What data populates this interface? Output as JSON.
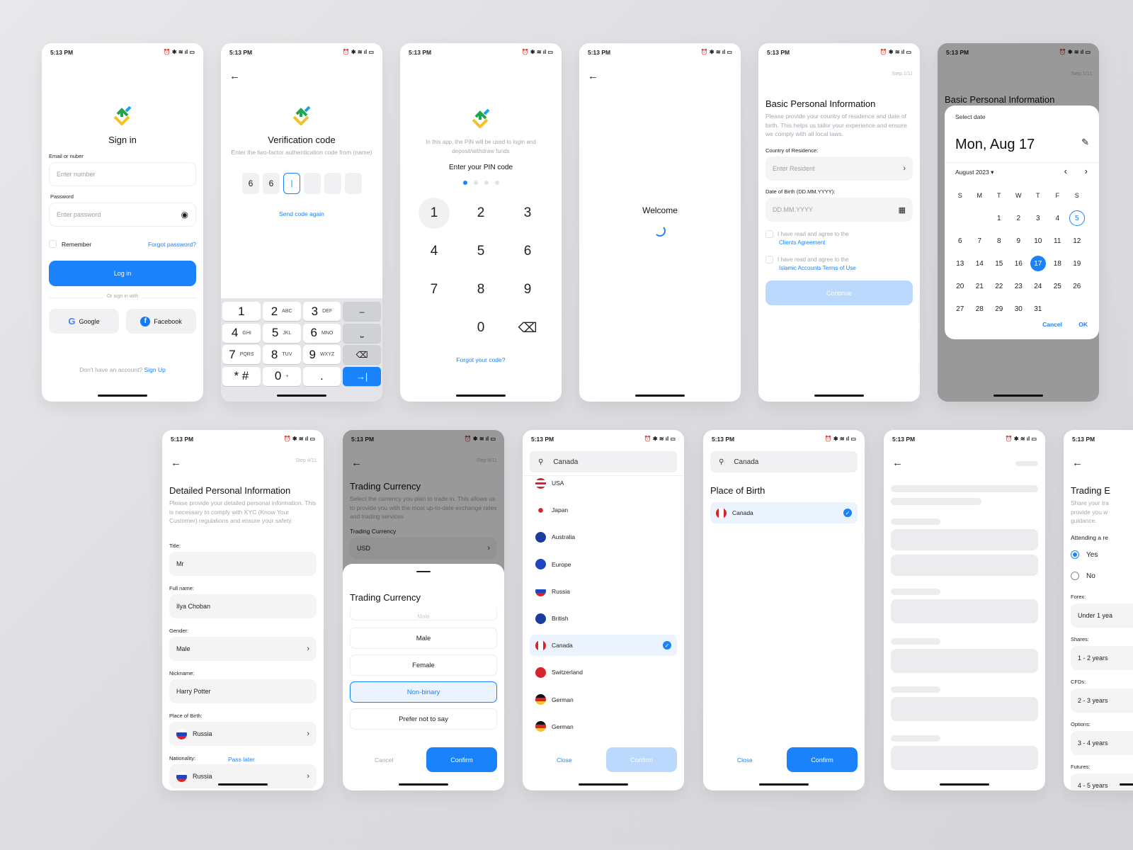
{
  "status": {
    "time": "5:13 PM",
    "icons": [
      "alarm-icon",
      "bluetooth-icon",
      "wifi-icon",
      "signal-icon",
      "battery-icon"
    ]
  },
  "brand": {
    "accent": "#1a82fb",
    "logo_colors": [
      "#1fa64a",
      "#1aa3e8",
      "#f5c02b"
    ]
  },
  "signin": {
    "title": "Sign in",
    "email_label": "Email or nuber",
    "email_placeholder": "Enter number",
    "password_label": "Password",
    "password_placeholder": "Enter password",
    "remember": "Remember",
    "forgot": "Forgot password?",
    "login": "Log in",
    "or": "Or sign in with",
    "google": "Google",
    "facebook": "Facebook",
    "no_account": "Don't have an account?",
    "signup": "Sign Up"
  },
  "verify": {
    "title": "Verification code",
    "subtitle": "Enter the two-factor authentication code from (name)",
    "digits": [
      "6",
      "6",
      "|",
      "",
      "",
      ""
    ],
    "resend": "Send code again",
    "keys": [
      [
        "1",
        ""
      ],
      [
        "2",
        "ABC"
      ],
      [
        "3",
        "DEF"
      ],
      [
        "–",
        ""
      ],
      [
        "4",
        "GHI"
      ],
      [
        "5",
        "JKL"
      ],
      [
        "6",
        "MNO"
      ],
      [
        "⎵",
        ""
      ],
      [
        "7",
        "PQRS"
      ],
      [
        "8",
        "TUV"
      ],
      [
        "9",
        "WXYZ"
      ],
      [
        "⌫",
        ""
      ],
      [
        "* #",
        ""
      ],
      [
        "0",
        "+"
      ],
      [
        ".",
        ""
      ],
      [
        "→|",
        ""
      ]
    ]
  },
  "pin": {
    "info": "In this app, the PIN will be used to login and deposit/withdraw funds",
    "title": "Enter your PIN code",
    "filled": 1,
    "total": 4,
    "keys": [
      "1",
      "2",
      "3",
      "4",
      "5",
      "6",
      "7",
      "8",
      "9",
      "",
      "0",
      "⌫"
    ],
    "forgot": "Forgot your code?"
  },
  "welcome": {
    "title": "Welcome"
  },
  "basic": {
    "step": "Step 1/11",
    "title": "Basic Personal Information",
    "subtitle": "Please provide your country of residence and date of birth. This helps us tailor your experience and ensure we comply with all local laws.",
    "country_label": "Country of Residence:",
    "country_placeholder": "Enter Resident",
    "dob_label": "Date of Birth (DD.MM.YYYY):",
    "dob_placeholder": "DD.MM.YYYY",
    "agree_text": "I have read and agree to the",
    "agree1_link": "Clients Agreement",
    "agree2_link": "Islamic Accounts Terms of Use",
    "continue": "Continue"
  },
  "datepicker": {
    "step": "Step 1/11",
    "bg_title": "Basic Personal Information",
    "header": "Select date",
    "selected": "Mon, Aug 17",
    "month": "August 2023",
    "weekdays": [
      "S",
      "M",
      "T",
      "W",
      "T",
      "F",
      "S"
    ],
    "days": [
      "",
      "",
      "1",
      "2",
      "3",
      "4",
      "5",
      "6",
      "7",
      "8",
      "9",
      "10",
      "11",
      "12",
      "13",
      "14",
      "15",
      "16",
      "17",
      "18",
      "19",
      "20",
      "21",
      "22",
      "23",
      "24",
      "25",
      "26",
      "27",
      "28",
      "29",
      "30",
      "31"
    ],
    "selected_day": "17",
    "today": "5",
    "cancel": "Cancel",
    "ok": "OK"
  },
  "detailed": {
    "step": "Step 4/11",
    "title": "Detailed Personal Information",
    "subtitle": "Please provide your detailed personal information. This is necessary to comply with KYC (Know Your Customer) regulations and ensure your safety.",
    "fields": [
      {
        "label": "Title:",
        "value": "Mr"
      },
      {
        "label": "Full name:",
        "value": "Ilya Choban"
      },
      {
        "label": "Gender:",
        "value": "Male"
      },
      {
        "label": "Nickname:",
        "value": "Harry Potter"
      },
      {
        "label": "Place of Birth:",
        "value": "Russia"
      },
      {
        "label": "Nationality:",
        "value": "Russia"
      }
    ],
    "pass_later": "Pass later"
  },
  "trading": {
    "step": "Step 8/11",
    "title": "Trading Currency",
    "subtitle": "Select the currency you plan to trade in. This allows us to provide you with the most up-to-date exchange rates and trading services",
    "label": "Trading Currency",
    "value": "USD",
    "sheet_title": "Trading Currency",
    "options": [
      "Male",
      "Male",
      "Female",
      "Non-binary",
      "Prefer not to say"
    ],
    "selected": "Non-binary",
    "cancel": "Cancel",
    "confirm": "Confirm"
  },
  "countries": {
    "search": "Canada",
    "items": [
      "USA",
      "Japan",
      "Australia",
      "Europe",
      "Russia",
      "British",
      "Canada",
      "Switzerland",
      "German",
      "German"
    ],
    "selected": "Canada",
    "close": "Close",
    "confirm": "Confirm"
  },
  "birthplace": {
    "search": "Canada",
    "title": "Place of Birth",
    "item": "Canada",
    "close": "Close",
    "confirm": "Confirm"
  },
  "experience": {
    "title": "Trading E",
    "subtitle": "Share your tra provide you w guidance.",
    "question": "Attending a re",
    "yes": "Yes",
    "no": "No",
    "fields": [
      {
        "label": "Forex:",
        "value": "Under 1 yea"
      },
      {
        "label": "Shares:",
        "value": "1 - 2 years"
      },
      {
        "label": "CFDs:",
        "value": "2 - 3 years"
      },
      {
        "label": "Options:",
        "value": "3 - 4 years"
      },
      {
        "label": "Futures:",
        "value": "4 - 5 years"
      }
    ]
  }
}
